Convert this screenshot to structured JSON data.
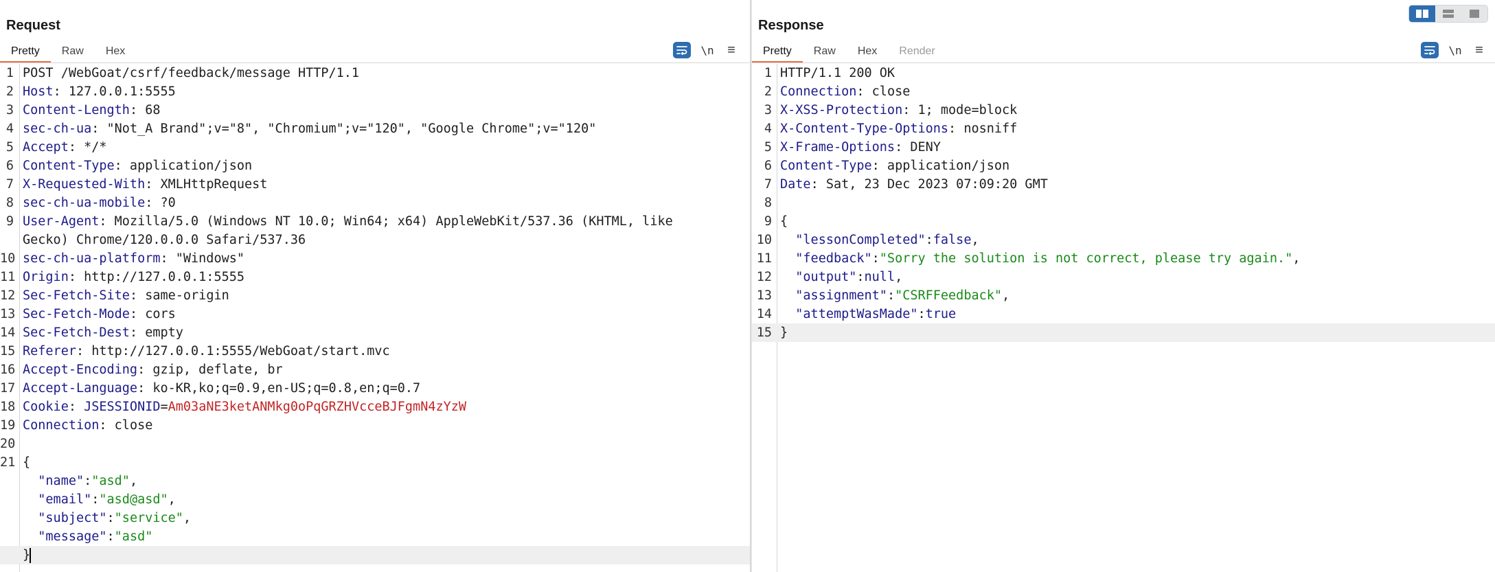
{
  "request": {
    "title": "Request",
    "tabs": [
      {
        "label": "Pretty",
        "active": true
      },
      {
        "label": "Raw"
      },
      {
        "label": "Hex"
      }
    ],
    "toolbar": {
      "newline_label": "\\n",
      "menu_label": "≡",
      "wrap_icon": "wrap-lines-icon"
    },
    "lines": [
      {
        "n": "1",
        "parts": [
          {
            "t": "POST /WebGoat/csrf/feedback/message HTTP/1.1",
            "c": "plain"
          }
        ]
      },
      {
        "n": "2",
        "parts": [
          {
            "t": "Host",
            "c": "hn"
          },
          {
            "t": ": 127.0.0.1:5555",
            "c": "hv"
          }
        ]
      },
      {
        "n": "3",
        "parts": [
          {
            "t": "Content-Length",
            "c": "hn"
          },
          {
            "t": ": 68",
            "c": "hv"
          }
        ]
      },
      {
        "n": "4",
        "parts": [
          {
            "t": "sec-ch-ua",
            "c": "hn"
          },
          {
            "t": ": \"Not_A Brand\";v=\"8\", \"Chromium\";v=\"120\", \"Google Chrome\";v=\"120\"",
            "c": "hv"
          }
        ]
      },
      {
        "n": "5",
        "parts": [
          {
            "t": "Accept",
            "c": "hn"
          },
          {
            "t": ": */*",
            "c": "hv"
          }
        ]
      },
      {
        "n": "6",
        "parts": [
          {
            "t": "Content-Type",
            "c": "hn"
          },
          {
            "t": ": application/json",
            "c": "hv"
          }
        ]
      },
      {
        "n": "7",
        "parts": [
          {
            "t": "X-Requested-With",
            "c": "hn"
          },
          {
            "t": ": XMLHttpRequest",
            "c": "hv"
          }
        ]
      },
      {
        "n": "8",
        "parts": [
          {
            "t": "sec-ch-ua-mobile",
            "c": "hn"
          },
          {
            "t": ": ?0",
            "c": "hv"
          }
        ]
      },
      {
        "n": "9",
        "parts": [
          {
            "t": "User-Agent",
            "c": "hn"
          },
          {
            "t": ": Mozilla/5.0 (Windows NT 10.0; Win64; x64) AppleWebKit/537.36 (KHTML, like",
            "c": "hv"
          }
        ]
      },
      {
        "n": "",
        "parts": [
          {
            "t": "Gecko) Chrome/120.0.0.0 Safari/537.36",
            "c": "hv"
          }
        ]
      },
      {
        "n": "10",
        "parts": [
          {
            "t": "sec-ch-ua-platform",
            "c": "hn"
          },
          {
            "t": ": \"Windows\"",
            "c": "hv"
          }
        ]
      },
      {
        "n": "11",
        "parts": [
          {
            "t": "Origin",
            "c": "hn"
          },
          {
            "t": ": http://127.0.0.1:5555",
            "c": "hv"
          }
        ]
      },
      {
        "n": "12",
        "parts": [
          {
            "t": "Sec-Fetch-Site",
            "c": "hn"
          },
          {
            "t": ": same-origin",
            "c": "hv"
          }
        ]
      },
      {
        "n": "13",
        "parts": [
          {
            "t": "Sec-Fetch-Mode",
            "c": "hn"
          },
          {
            "t": ": cors",
            "c": "hv"
          }
        ]
      },
      {
        "n": "14",
        "parts": [
          {
            "t": "Sec-Fetch-Dest",
            "c": "hn"
          },
          {
            "t": ": empty",
            "c": "hv"
          }
        ]
      },
      {
        "n": "15",
        "parts": [
          {
            "t": "Referer",
            "c": "hn"
          },
          {
            "t": ": http://127.0.0.1:5555/WebGoat/start.mvc",
            "c": "hv"
          }
        ]
      },
      {
        "n": "16",
        "parts": [
          {
            "t": "Accept-Encoding",
            "c": "hn"
          },
          {
            "t": ": gzip, deflate, br",
            "c": "hv"
          }
        ]
      },
      {
        "n": "17",
        "parts": [
          {
            "t": "Accept-Language",
            "c": "hn"
          },
          {
            "t": ": ko-KR,ko;q=0.9,en-US;q=0.8,en;q=0.7",
            "c": "hv"
          }
        ]
      },
      {
        "n": "18",
        "parts": [
          {
            "t": "Cookie",
            "c": "hn"
          },
          {
            "t": ": ",
            "c": "hv"
          },
          {
            "t": "JSESSIONID",
            "c": "ck-name"
          },
          {
            "t": "=",
            "c": "hv"
          },
          {
            "t": "Am03aNE3ketANMkg0oPqGRZHVcceBJFgmN4zYzW",
            "c": "ck-val"
          }
        ]
      },
      {
        "n": "19",
        "parts": [
          {
            "t": "Connection",
            "c": "hn"
          },
          {
            "t": ": close",
            "c": "hv"
          }
        ]
      },
      {
        "n": "20",
        "parts": []
      },
      {
        "n": "21",
        "parts": [
          {
            "t": "{",
            "c": "plain"
          }
        ]
      },
      {
        "n": "",
        "parts": [
          {
            "t": "  \"name\"",
            "c": "js-key"
          },
          {
            "t": ":",
            "c": "plain"
          },
          {
            "t": "\"asd\"",
            "c": "js-str"
          },
          {
            "t": ",",
            "c": "plain"
          }
        ]
      },
      {
        "n": "",
        "parts": [
          {
            "t": "  \"email\"",
            "c": "js-key"
          },
          {
            "t": ":",
            "c": "plain"
          },
          {
            "t": "\"asd@asd\"",
            "c": "js-str"
          },
          {
            "t": ",",
            "c": "plain"
          }
        ]
      },
      {
        "n": "",
        "parts": [
          {
            "t": "  \"subject\"",
            "c": "js-key"
          },
          {
            "t": ":",
            "c": "plain"
          },
          {
            "t": "\"service\"",
            "c": "js-str"
          },
          {
            "t": ",",
            "c": "plain"
          }
        ]
      },
      {
        "n": "",
        "parts": [
          {
            "t": "  \"message\"",
            "c": "js-key"
          },
          {
            "t": ":",
            "c": "plain"
          },
          {
            "t": "\"asd\"",
            "c": "js-str"
          }
        ]
      },
      {
        "n": "",
        "parts": [
          {
            "t": "}",
            "c": "plain"
          }
        ],
        "current": true,
        "caret": true
      }
    ]
  },
  "response": {
    "title": "Response",
    "tabs": [
      {
        "label": "Pretty",
        "active": true
      },
      {
        "label": "Raw"
      },
      {
        "label": "Hex"
      },
      {
        "label": "Render",
        "disabled": true
      }
    ],
    "toolbar": {
      "newline_label": "\\n",
      "menu_label": "≡",
      "wrap_icon": "wrap-lines-icon"
    },
    "lines": [
      {
        "n": "1",
        "parts": [
          {
            "t": "HTTP/1.1 200 OK",
            "c": "plain"
          }
        ]
      },
      {
        "n": "2",
        "parts": [
          {
            "t": "Connection",
            "c": "hn"
          },
          {
            "t": ": close",
            "c": "hv"
          }
        ]
      },
      {
        "n": "3",
        "parts": [
          {
            "t": "X-XSS-Protection",
            "c": "hn"
          },
          {
            "t": ": 1; mode=block",
            "c": "hv"
          }
        ]
      },
      {
        "n": "4",
        "parts": [
          {
            "t": "X-Content-Type-Options",
            "c": "hn"
          },
          {
            "t": ": nosniff",
            "c": "hv"
          }
        ]
      },
      {
        "n": "5",
        "parts": [
          {
            "t": "X-Frame-Options",
            "c": "hn"
          },
          {
            "t": ": DENY",
            "c": "hv"
          }
        ]
      },
      {
        "n": "6",
        "parts": [
          {
            "t": "Content-Type",
            "c": "hn"
          },
          {
            "t": ": application/json",
            "c": "hv"
          }
        ]
      },
      {
        "n": "7",
        "parts": [
          {
            "t": "Date",
            "c": "hn"
          },
          {
            "t": ": Sat, 23 Dec 2023 07:09:20 GMT",
            "c": "hv"
          }
        ]
      },
      {
        "n": "8",
        "parts": []
      },
      {
        "n": "9",
        "parts": [
          {
            "t": "{",
            "c": "plain"
          }
        ]
      },
      {
        "n": "10",
        "parts": [
          {
            "t": "  \"lessonCompleted\"",
            "c": "js-key"
          },
          {
            "t": ":",
            "c": "plain"
          },
          {
            "t": "false",
            "c": "js-lit"
          },
          {
            "t": ",",
            "c": "plain"
          }
        ]
      },
      {
        "n": "11",
        "parts": [
          {
            "t": "  \"feedback\"",
            "c": "js-key"
          },
          {
            "t": ":",
            "c": "plain"
          },
          {
            "t": "\"Sorry the solution is not correct, please try again.\"",
            "c": "js-str"
          },
          {
            "t": ",",
            "c": "plain"
          }
        ]
      },
      {
        "n": "12",
        "parts": [
          {
            "t": "  \"output\"",
            "c": "js-key"
          },
          {
            "t": ":",
            "c": "plain"
          },
          {
            "t": "null",
            "c": "js-lit"
          },
          {
            "t": ",",
            "c": "plain"
          }
        ]
      },
      {
        "n": "13",
        "parts": [
          {
            "t": "  \"assignment\"",
            "c": "js-key"
          },
          {
            "t": ":",
            "c": "plain"
          },
          {
            "t": "\"CSRFFeedback\"",
            "c": "js-str"
          },
          {
            "t": ",",
            "c": "plain"
          }
        ]
      },
      {
        "n": "14",
        "parts": [
          {
            "t": "  \"attemptWasMade\"",
            "c": "js-key"
          },
          {
            "t": ":",
            "c": "plain"
          },
          {
            "t": "true",
            "c": "js-lit"
          }
        ]
      },
      {
        "n": "15",
        "parts": [
          {
            "t": "}",
            "c": "plain"
          }
        ],
        "current": true
      }
    ]
  },
  "layout_switch": {
    "buttons": [
      {
        "name": "side-by-side-layout-icon",
        "active": true
      },
      {
        "name": "stacked-layout-icon"
      },
      {
        "name": "single-pane-layout-icon"
      }
    ]
  },
  "colors": {
    "accent_tab_underline": "#e8724a",
    "header_name": "#1d1b8a",
    "json_string": "#1a8a1a",
    "cookie_value": "#c32525",
    "toolbar_button": "#2d6db0"
  }
}
